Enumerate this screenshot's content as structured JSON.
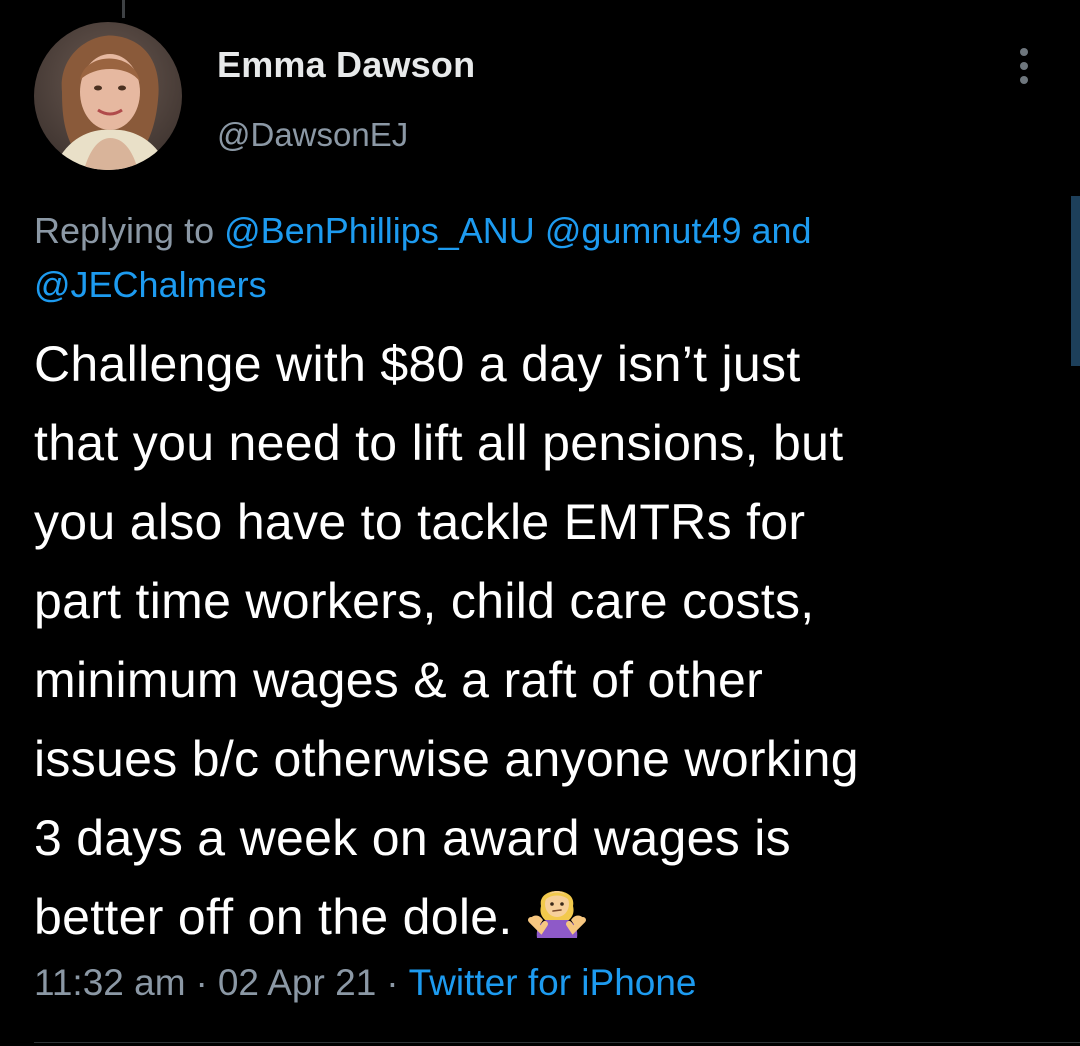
{
  "author": {
    "display_name": "Emma Dawson",
    "handle": "@DawsonEJ"
  },
  "reply": {
    "prefix": "Replying to",
    "mention_1": "@BenPhillips_ANU",
    "mention_2": "@gumnut49",
    "conjunction": "and",
    "mention_3": "@JEChalmers"
  },
  "tweet": {
    "lines": [
      "Challenge with $80 a day isn’t just",
      "that you need to lift all pensions, but",
      "you also have to tackle EMTRs for",
      "part time workers, child care costs,",
      "minimum wages & a raft of other",
      "issues b/c otherwise anyone working",
      "3 days a week on award wages is",
      "better off on the dole."
    ],
    "emoji_icon": "person-shrugging-emoji"
  },
  "meta": {
    "time": "11:32 am",
    "separator": "·",
    "date": "02 Apr 21",
    "source": "Twitter for iPhone"
  },
  "colors": {
    "background": "#000000",
    "text": "#ffffff",
    "secondary": "#8b98a5",
    "link": "#1d9bf0"
  }
}
